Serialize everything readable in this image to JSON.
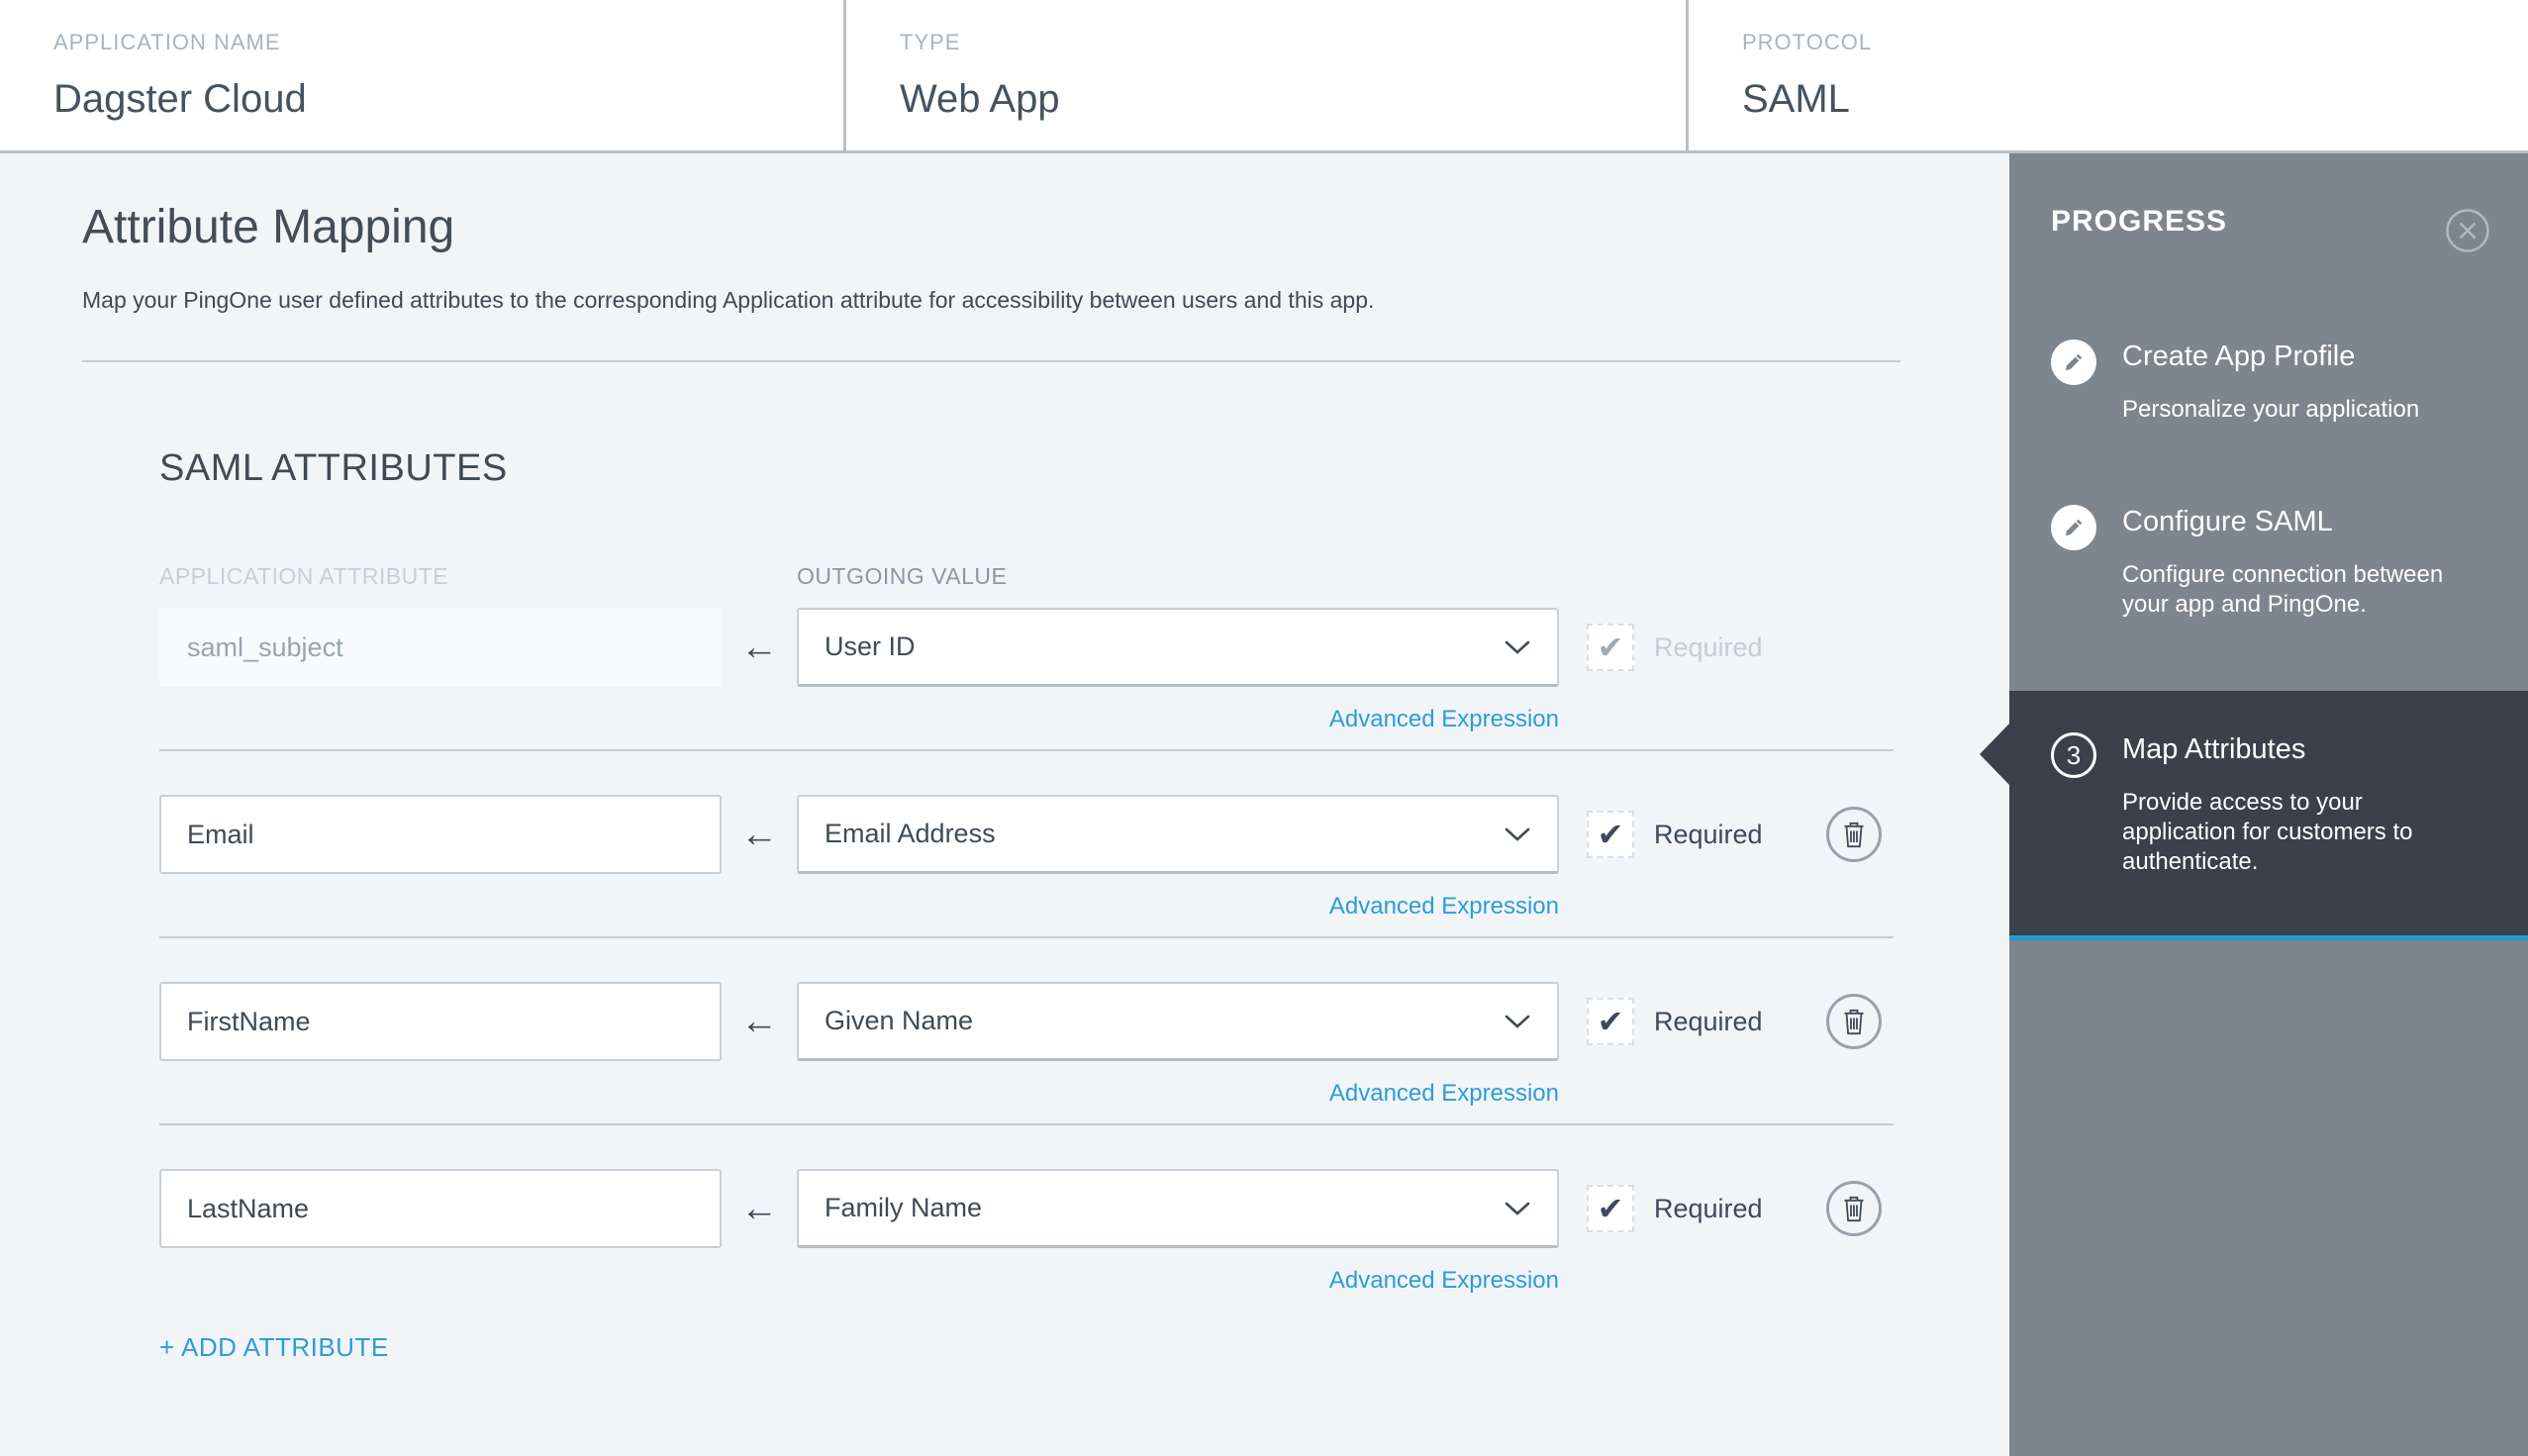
{
  "header": {
    "application_name_label": "APPLICATION NAME",
    "application_name": "Dagster Cloud",
    "type_label": "TYPE",
    "type": "Web App",
    "protocol_label": "PROTOCOL",
    "protocol": "SAML"
  },
  "main": {
    "title": "Attribute Mapping",
    "description": "Map your PingOne user defined attributes to the corresponding Application attribute for accessibility between users and this app.",
    "section_title": "SAML ATTRIBUTES",
    "column_application_attribute": "APPLICATION ATTRIBUTE",
    "column_outgoing_value": "OUTGOING VALUE",
    "advanced_expression_label": "Advanced Expression",
    "required_label": "Required",
    "add_attribute_label": "+ ADD ATTRIBUTE",
    "rows": [
      {
        "application_attribute": "saml_subject",
        "outgoing_value": "User ID",
        "required_checked": true,
        "disabled": true,
        "deletable": false
      },
      {
        "application_attribute": "Email",
        "outgoing_value": "Email Address",
        "required_checked": true,
        "disabled": false,
        "deletable": true
      },
      {
        "application_attribute": "FirstName",
        "outgoing_value": "Given Name",
        "required_checked": true,
        "disabled": false,
        "deletable": true
      },
      {
        "application_attribute": "LastName",
        "outgoing_value": "Family Name",
        "required_checked": true,
        "disabled": false,
        "deletable": true
      }
    ]
  },
  "sidebar": {
    "title": "PROGRESS",
    "steps": [
      {
        "title": "Create App Profile",
        "subtitle": "Personalize your application",
        "icon": "pencil-icon",
        "active": false
      },
      {
        "title": "Configure SAML",
        "subtitle": "Configure connection between your app and PingOne.",
        "icon": "pencil-icon",
        "active": false
      },
      {
        "number": "3",
        "title": "Map Attributes",
        "subtitle": "Provide access to your application for customers to authenticate.",
        "icon": "step-number",
        "active": true
      }
    ]
  },
  "icons": {
    "check": "✔",
    "arrow_left": "←"
  },
  "colors": {
    "link_blue": "#2d9cd8",
    "accent_blue": "#1d9cd8",
    "sidebar_gray": "#7d858e",
    "sidebar_active_dark": "#3a414b",
    "text_dark": "#3f4a55",
    "page_background": "#f2f5f8"
  }
}
